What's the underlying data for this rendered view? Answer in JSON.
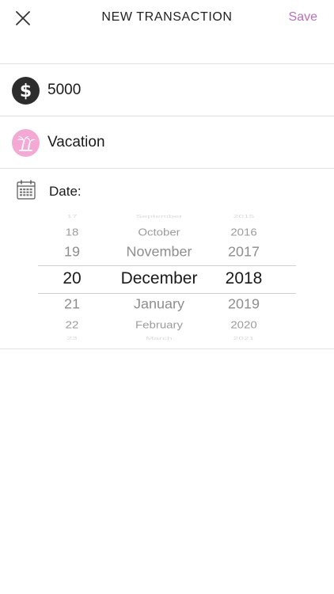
{
  "header": {
    "title": "NEW TRANSACTION",
    "save_label": "Save"
  },
  "amount": {
    "value": "5000",
    "icon": "dollar-icon"
  },
  "category": {
    "label": "Vacation",
    "icon": "palm-tree-icon"
  },
  "date": {
    "label": "Date:",
    "icon": "calendar-icon",
    "picker": {
      "days": [
        "17",
        "18",
        "19",
        "20",
        "21",
        "22",
        "23"
      ],
      "months": [
        "September",
        "October",
        "November",
        "December",
        "January",
        "February",
        "March"
      ],
      "years": [
        "2015",
        "2016",
        "2017",
        "2018",
        "2019",
        "2020",
        "2021"
      ],
      "selected_day": "20",
      "selected_month": "December",
      "selected_year": "2018"
    }
  },
  "colors": {
    "accent": "#b86fc0",
    "category_icon_bg": "#f4a9d4",
    "amount_icon_bg": "#2d2d2d"
  }
}
